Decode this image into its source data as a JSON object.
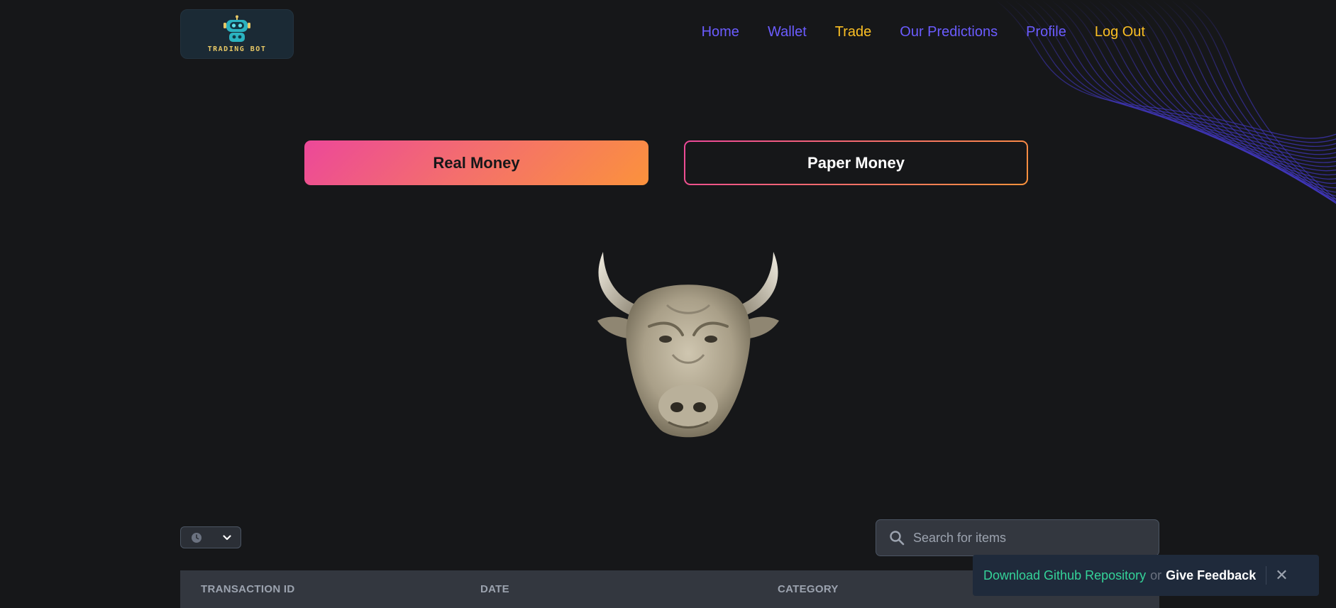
{
  "brand": {
    "logo_text": "TRADING BOT"
  },
  "nav": {
    "items": [
      {
        "label": "Home"
      },
      {
        "label": "Wallet"
      },
      {
        "label": "Trade"
      },
      {
        "label": "Our Predictions"
      },
      {
        "label": "Profile"
      },
      {
        "label": "Log Out"
      }
    ],
    "active_item": "Trade"
  },
  "mode": {
    "real_label": "Real Money",
    "paper_label": "Paper Money",
    "selected": "Real Money"
  },
  "hero_icon": "bull-head-icon",
  "filters": {
    "time_icon": "clock-icon",
    "dropdown_icon": "chevron-down-icon"
  },
  "search": {
    "placeholder": "Search for items",
    "value": ""
  },
  "table": {
    "columns": [
      "TRANSACTION ID",
      "DATE",
      "CATEGORY"
    ]
  },
  "toast": {
    "download_label": "Download Github Repository",
    "or_label": "or",
    "feedback_label": "Give Feedback",
    "close_icon": "close-icon"
  },
  "colors": {
    "background": "#161719",
    "nav_link": "#6b5cff",
    "nav_active": "#fbbf24",
    "gradient_start": "#ec4899",
    "gradient_end": "#fb923c",
    "toast_link": "#34d399"
  }
}
